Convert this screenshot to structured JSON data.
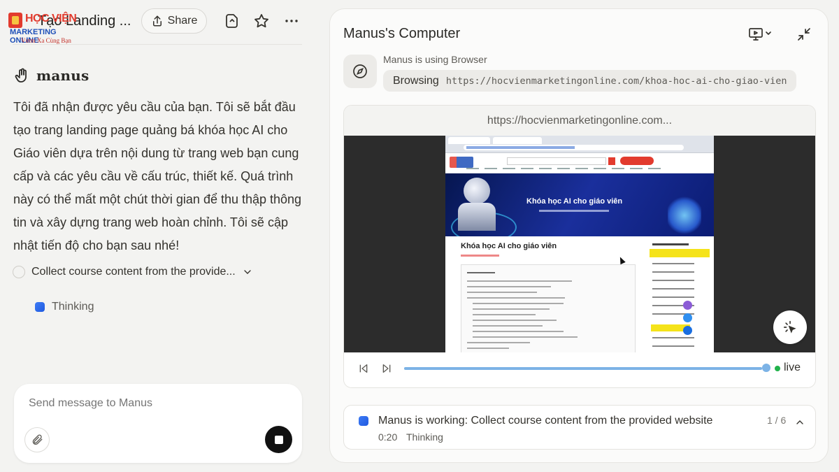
{
  "header": {
    "logo": {
      "line1": "HỌC VIỆN",
      "line2": "MARKETING ONLINE",
      "tagline": "Vươn Xa Cùng Bạn"
    },
    "task_title": "Tạo Landing ...",
    "share_label": "Share",
    "icons": [
      "file-icon",
      "star-icon",
      "more-icon"
    ]
  },
  "chat": {
    "brand_name": "manus",
    "message": "Tôi đã nhận được yêu cầu của bạn. Tôi sẽ bắt đầu tạo trang landing page quảng bá khóa học AI cho Giáo viên dựa trên nội dung từ trang web bạn cung cấp và các yêu cầu về cấu trúc, thiết kế. Quá trình này có thể mất một chút thời gian để thu thập thông tin và xây dựng trang web hoàn chỉnh. Tôi sẽ cập nhật tiến độ cho bạn sau nhé!",
    "task_label": "Collect course content from the provide...",
    "thinking_label": "Thinking"
  },
  "composer": {
    "placeholder": "Send message to Manus"
  },
  "computer": {
    "title": "Manus's Computer",
    "tool_status": "Manus is using Browser",
    "action_label": "Browsing",
    "action_url": "https://hocvienmarketingonline.com/khoa-hoc-ai-cho-giao-vien",
    "viewer_url": "https://hocvienmarketingonline.com...",
    "site": {
      "hero_title": "Khóa học AI cho giáo viên",
      "page_heading": "Khóa học AI cho giáo viên"
    },
    "playback": {
      "live_label": "live",
      "progress": 1.0
    }
  },
  "status": {
    "text": "Manus is working: Collect course content from the provided website",
    "elapsed": "0:20",
    "state": "Thinking",
    "step_count": "1 / 6"
  },
  "colors": {
    "accent_blue": "#3d7bf5",
    "live_green": "#22b24c",
    "progress": "#7cb3e6",
    "stop_button": "#111111"
  }
}
